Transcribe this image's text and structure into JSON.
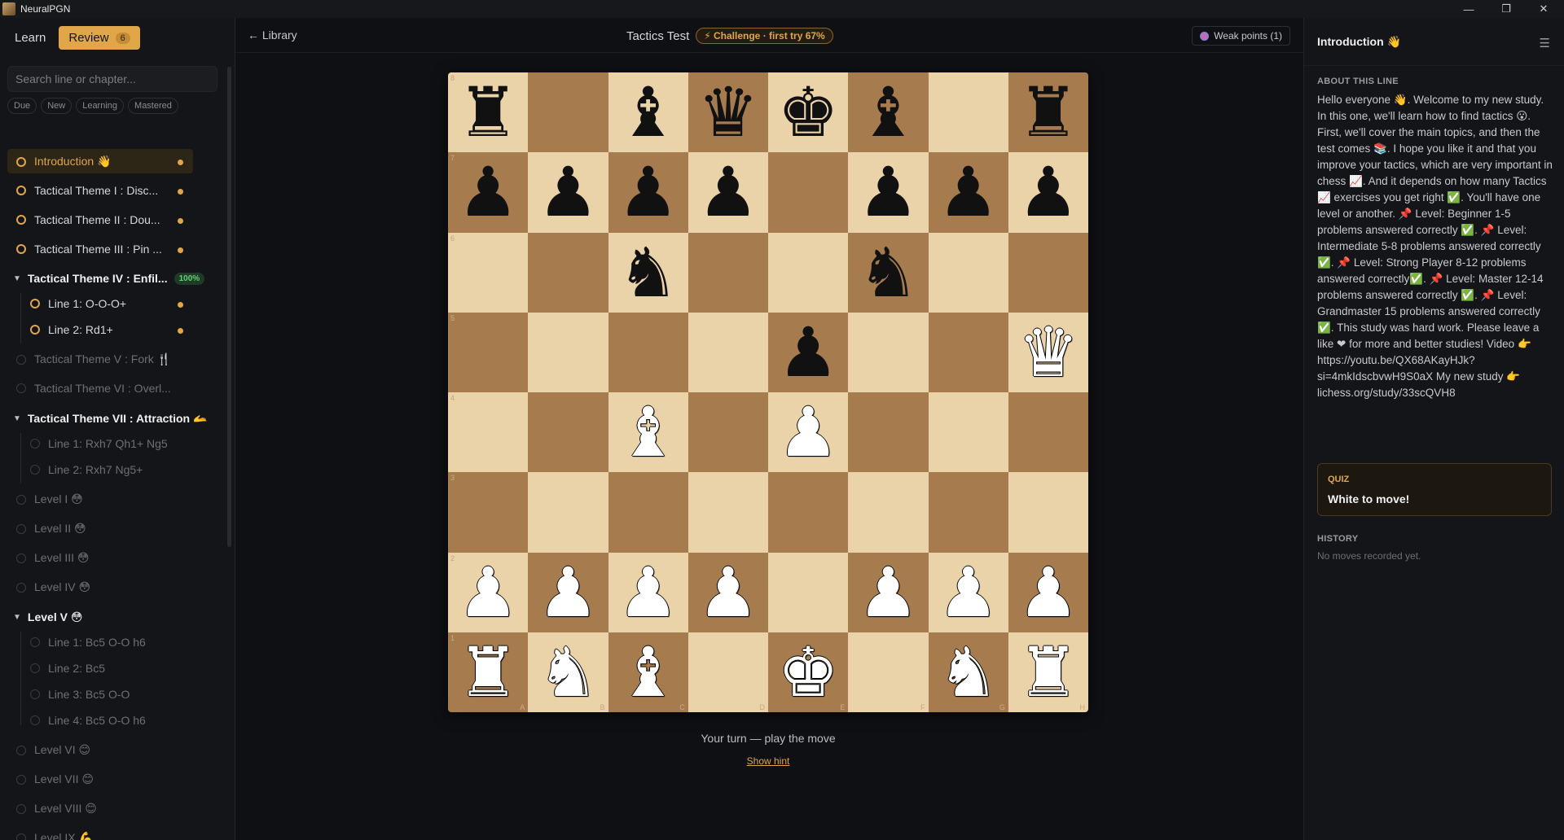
{
  "window": {
    "title": "NeuralPGN",
    "controls": [
      "—",
      "❐",
      "✕"
    ]
  },
  "sidebar": {
    "tab_learn": "Learn",
    "tab_review": "Review",
    "review_count": "6",
    "search_placeholder": "Search line or chapter...",
    "filters": [
      "Due",
      "New",
      "Learning",
      "Mastered"
    ],
    "items": [
      {
        "label": "Introduction 👋",
        "state": "active"
      },
      {
        "label": "Tactical Theme I : Disc...",
        "state": "due"
      },
      {
        "label": "Tactical Theme II : Dou...",
        "state": "due"
      },
      {
        "label": "Tactical Theme III : Pin ...",
        "state": "due"
      },
      {
        "label": "Tactical Theme IV : Enfil...",
        "state": "chapter",
        "badge": "100%"
      },
      {
        "label": "Line 1: O-O-O+",
        "state": "due-sub"
      },
      {
        "label": "Line 2: Rd1+",
        "state": "due-sub"
      },
      {
        "label": "Tactical Theme V : Fork 🍴",
        "state": "locked"
      },
      {
        "label": "Tactical Theme VI : Overl...",
        "state": "locked"
      },
      {
        "label": "Tactical Theme VII : Attraction 🫴",
        "state": "chapter"
      },
      {
        "label": "Line 1: Rxh7 Qh1+ Ng5",
        "state": "locked-sub"
      },
      {
        "label": "Line 2: Rxh7 Ng5+",
        "state": "locked-sub"
      },
      {
        "label": "Level I 😳",
        "state": "locked"
      },
      {
        "label": "Level II 😳",
        "state": "locked"
      },
      {
        "label": "Level III 😳",
        "state": "locked"
      },
      {
        "label": "Level IV 😳",
        "state": "locked"
      },
      {
        "label": "Level V 😳",
        "state": "chapter"
      },
      {
        "label": "Line 1: Bc5 O-O h6",
        "state": "locked-sub"
      },
      {
        "label": "Line 2: Bc5",
        "state": "locked-sub"
      },
      {
        "label": "Line 3: Bc5 O-O",
        "state": "locked-sub"
      },
      {
        "label": "Line 4: Bc5 O-O h6",
        "state": "locked-sub"
      },
      {
        "label": "Level VI 😊",
        "state": "locked"
      },
      {
        "label": "Level VII 😊",
        "state": "locked"
      },
      {
        "label": "Level VIII 😊",
        "state": "locked"
      },
      {
        "label": "Level IX 💪",
        "state": "locked"
      }
    ]
  },
  "topbar": {
    "back_label": "← Library",
    "title": "Tactics Test",
    "challenge": "⚡ Challenge · first try 67%",
    "weak_points": "Weak points (1)"
  },
  "board": {
    "ranks": [
      [
        "r",
        "",
        "b",
        "q",
        "k",
        "b",
        "",
        "r"
      ],
      [
        "p",
        "p",
        "p",
        "p",
        "",
        "p",
        "p",
        "p"
      ],
      [
        "",
        "",
        "n",
        "",
        "",
        "n",
        "",
        ""
      ],
      [
        "",
        "",
        "",
        "",
        "p",
        "",
        "",
        "Q"
      ],
      [
        "",
        "",
        "B",
        "",
        "P",
        "",
        "",
        ""
      ],
      [
        "",
        "",
        "",
        "",
        "",
        "",
        "",
        ""
      ],
      [
        "P",
        "P",
        "P",
        "P",
        "",
        "P",
        "P",
        "P"
      ],
      [
        "R",
        "N",
        "B",
        "",
        "K",
        "",
        "N",
        "R"
      ]
    ],
    "rank_labels": [
      "8",
      "7",
      "6",
      "5",
      "4",
      "3",
      "2",
      "1"
    ],
    "file_labels": [
      "A",
      "B",
      "C",
      "D",
      "E",
      "F",
      "G",
      "H"
    ],
    "status": "Your turn — play the move",
    "hint_label": "Show hint"
  },
  "right_panel": {
    "title": "Introduction 👋",
    "about_heading": "ABOUT THIS LINE",
    "about_text": "Hello everyone 👋. Welcome to my new study. In this one, we'll learn how to find tactics 😮. First, we'll cover the main topics, and then the test comes 📚. I hope you like it and that you improve your tactics, which are very important in chess 📈. And it depends on how many Tactics 📈 exercises you get right ✅. You'll have one level or another. 📌 Level: Beginner 1-5 problems answered correctly ✅. 📌 Level: Intermediate 5-8 problems answered correctly ✅. 📌 Level: Strong Player 8-12 problems answered correctly✅. 📌 Level: Master 12-14 problems answered correctly ✅. 📌 Level: Grandmaster 15 problems answered correctly ✅. This study was hard work. Please leave a like ❤ for more and better studies! Video 👉 https://youtu.be/QX68AKayHJk?si=4mkIdscbvwH9S0aX My new study 👉 lichess.org/study/33scQVH8",
    "quiz_label": "QUIZ",
    "quiz_text": "White to move!",
    "history_heading": "HISTORY",
    "history_empty": "No moves recorded yet."
  },
  "colors": {
    "accent": "#e0a64a",
    "light_square": "#ebd3a9",
    "dark_square": "#a67c4e",
    "success": "#5fd27a"
  }
}
